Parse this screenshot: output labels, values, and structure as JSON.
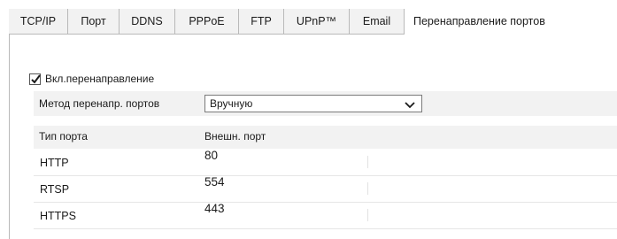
{
  "tabs": [
    {
      "label": "TCP/IP",
      "active": false
    },
    {
      "label": "Порт",
      "active": false
    },
    {
      "label": "DDNS",
      "active": false
    },
    {
      "label": "PPPoE",
      "active": false
    },
    {
      "label": "FTP",
      "active": false
    },
    {
      "label": "UPnP™",
      "active": false
    },
    {
      "label": "Email",
      "active": false
    },
    {
      "label": "Перенаправление портов",
      "active": true
    }
  ],
  "enable_forwarding": {
    "label": "Вкл.перенаправление",
    "checked": true
  },
  "method": {
    "label": "Метод перенапр. портов",
    "value": "Вручную"
  },
  "table": {
    "headers": [
      "Тип порта",
      "Внешн. порт"
    ],
    "rows": [
      {
        "type": "HTTP",
        "port": "80"
      },
      {
        "type": "RTSP",
        "port": "554"
      },
      {
        "type": "HTTPS",
        "port": "443"
      }
    ]
  },
  "colors": {
    "header_bg": "#f2f2f2",
    "border": "#b9b9b9"
  }
}
